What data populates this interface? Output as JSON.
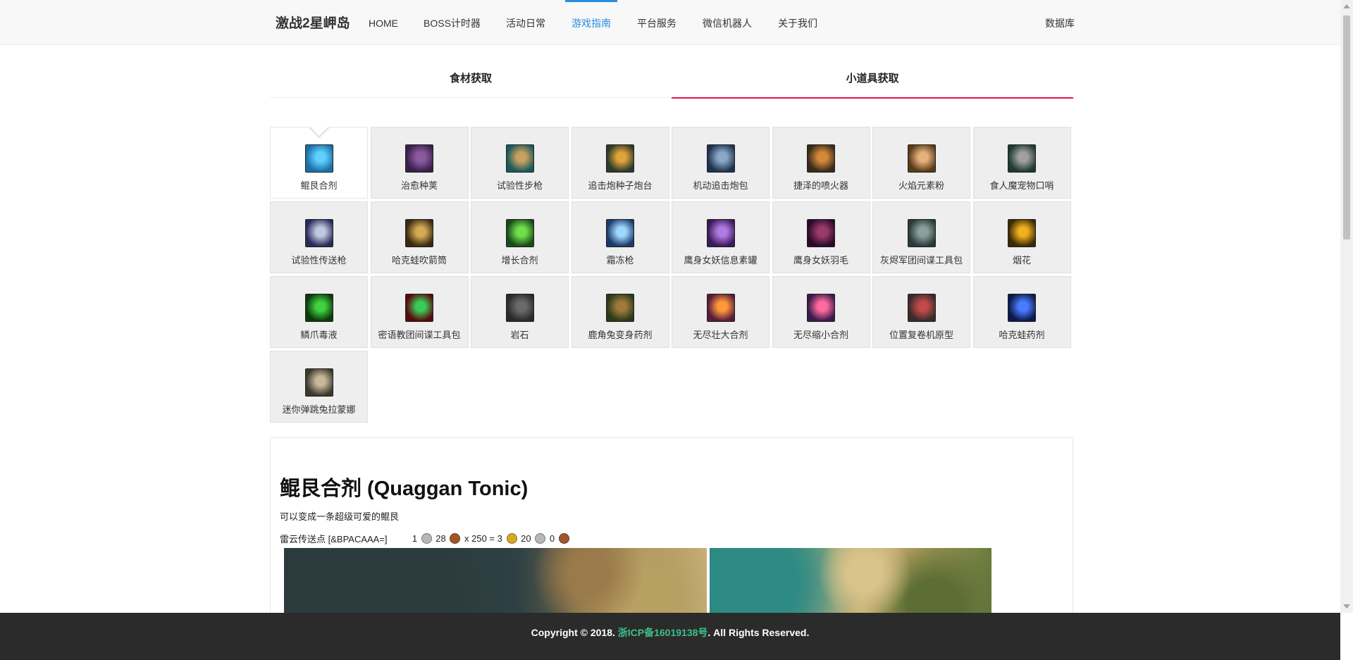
{
  "navbar": {
    "brand": "激战2星岬岛",
    "items": [
      {
        "label": "HOME"
      },
      {
        "label": "BOSS计时器"
      },
      {
        "label": "活动日常"
      },
      {
        "label": "游戏指南"
      },
      {
        "label": "平台服务"
      },
      {
        "label": "微信机器人"
      },
      {
        "label": "关于我们"
      }
    ],
    "active_item": "游戏指南",
    "right_link": "数据库"
  },
  "tabs": [
    {
      "label": "食材获取"
    },
    {
      "label": "小道具获取"
    }
  ],
  "active_tab": "小道具获取",
  "items": [
    {
      "label": "鲲艮合剂",
      "icon": "tonic-flask-icon"
    },
    {
      "label": "治愈种荚",
      "icon": "seed-pod-icon"
    },
    {
      "label": "试验性步枪",
      "icon": "rifle-icon"
    },
    {
      "label": "追击炮种子炮台",
      "icon": "turret-seed-icon"
    },
    {
      "label": "机动追击炮包",
      "icon": "mortar-kit-icon"
    },
    {
      "label": "捷泽的喷火器",
      "icon": "flamethrower-icon"
    },
    {
      "label": "火焰元素粉",
      "icon": "fire-powder-icon"
    },
    {
      "label": "食人魔宠物口哨",
      "icon": "whistle-icon"
    },
    {
      "label": "试验性传送枪",
      "icon": "teleport-gun-icon"
    },
    {
      "label": "哈克蛙吹箭筒",
      "icon": "blowgun-icon"
    },
    {
      "label": "增长合剂",
      "icon": "growth-tonic-icon"
    },
    {
      "label": "霜冻枪",
      "icon": "frost-gun-icon"
    },
    {
      "label": "鹰身女妖信息素罐",
      "icon": "pheromone-jar-icon"
    },
    {
      "label": "鹰身女妖羽毛",
      "icon": "feather-icon"
    },
    {
      "label": "灰烬军团间谍工具包",
      "icon": "spy-kit-icon"
    },
    {
      "label": "烟花",
      "icon": "firework-icon"
    },
    {
      "label": "鳞爪毒液",
      "icon": "venom-vial-icon"
    },
    {
      "label": "密语教团间谍工具包",
      "icon": "order-kit-icon"
    },
    {
      "label": "岩石",
      "icon": "rock-icon"
    },
    {
      "label": "鹿角兔变身药剂",
      "icon": "jackalope-potion-icon"
    },
    {
      "label": "无尽壮大合剂",
      "icon": "enlarge-tonic-icon"
    },
    {
      "label": "无尽缩小合剂",
      "icon": "shrink-tonic-icon"
    },
    {
      "label": "位置复卷机原型",
      "icon": "position-device-icon"
    },
    {
      "label": "哈克蛙药剂",
      "icon": "hylek-potion-icon"
    },
    {
      "label": "迷你弹跳兔拉蒙娜",
      "icon": "bunny-mini-icon"
    }
  ],
  "selected_item": "鲲艮合剂",
  "detail": {
    "title": "鲲艮合剂 (Quaggan Tonic)",
    "description": "可以变成一条超级可爱的鲲艮",
    "waypoint": "雷云传送点 [&BPACAAA=]",
    "price": {
      "silver": "1",
      "copper": "28",
      "multiplier": "x 250 =",
      "total_gold": "3",
      "total_silver": "20",
      "total_copper": "0"
    }
  },
  "footer": {
    "prefix": "Copyright © 2018.",
    "icp": "浙ICP备16019138号",
    "suffix": ". All Rights Reserved."
  },
  "colors": {
    "accent_blue": "#2a8de0",
    "tab_red": "#e5154a",
    "footer_bg": "#2b2b2b",
    "footer_link": "#3cbf8a",
    "gold": "#d4a82a",
    "silver": "#b7b7b7",
    "copper": "#a0582a"
  }
}
